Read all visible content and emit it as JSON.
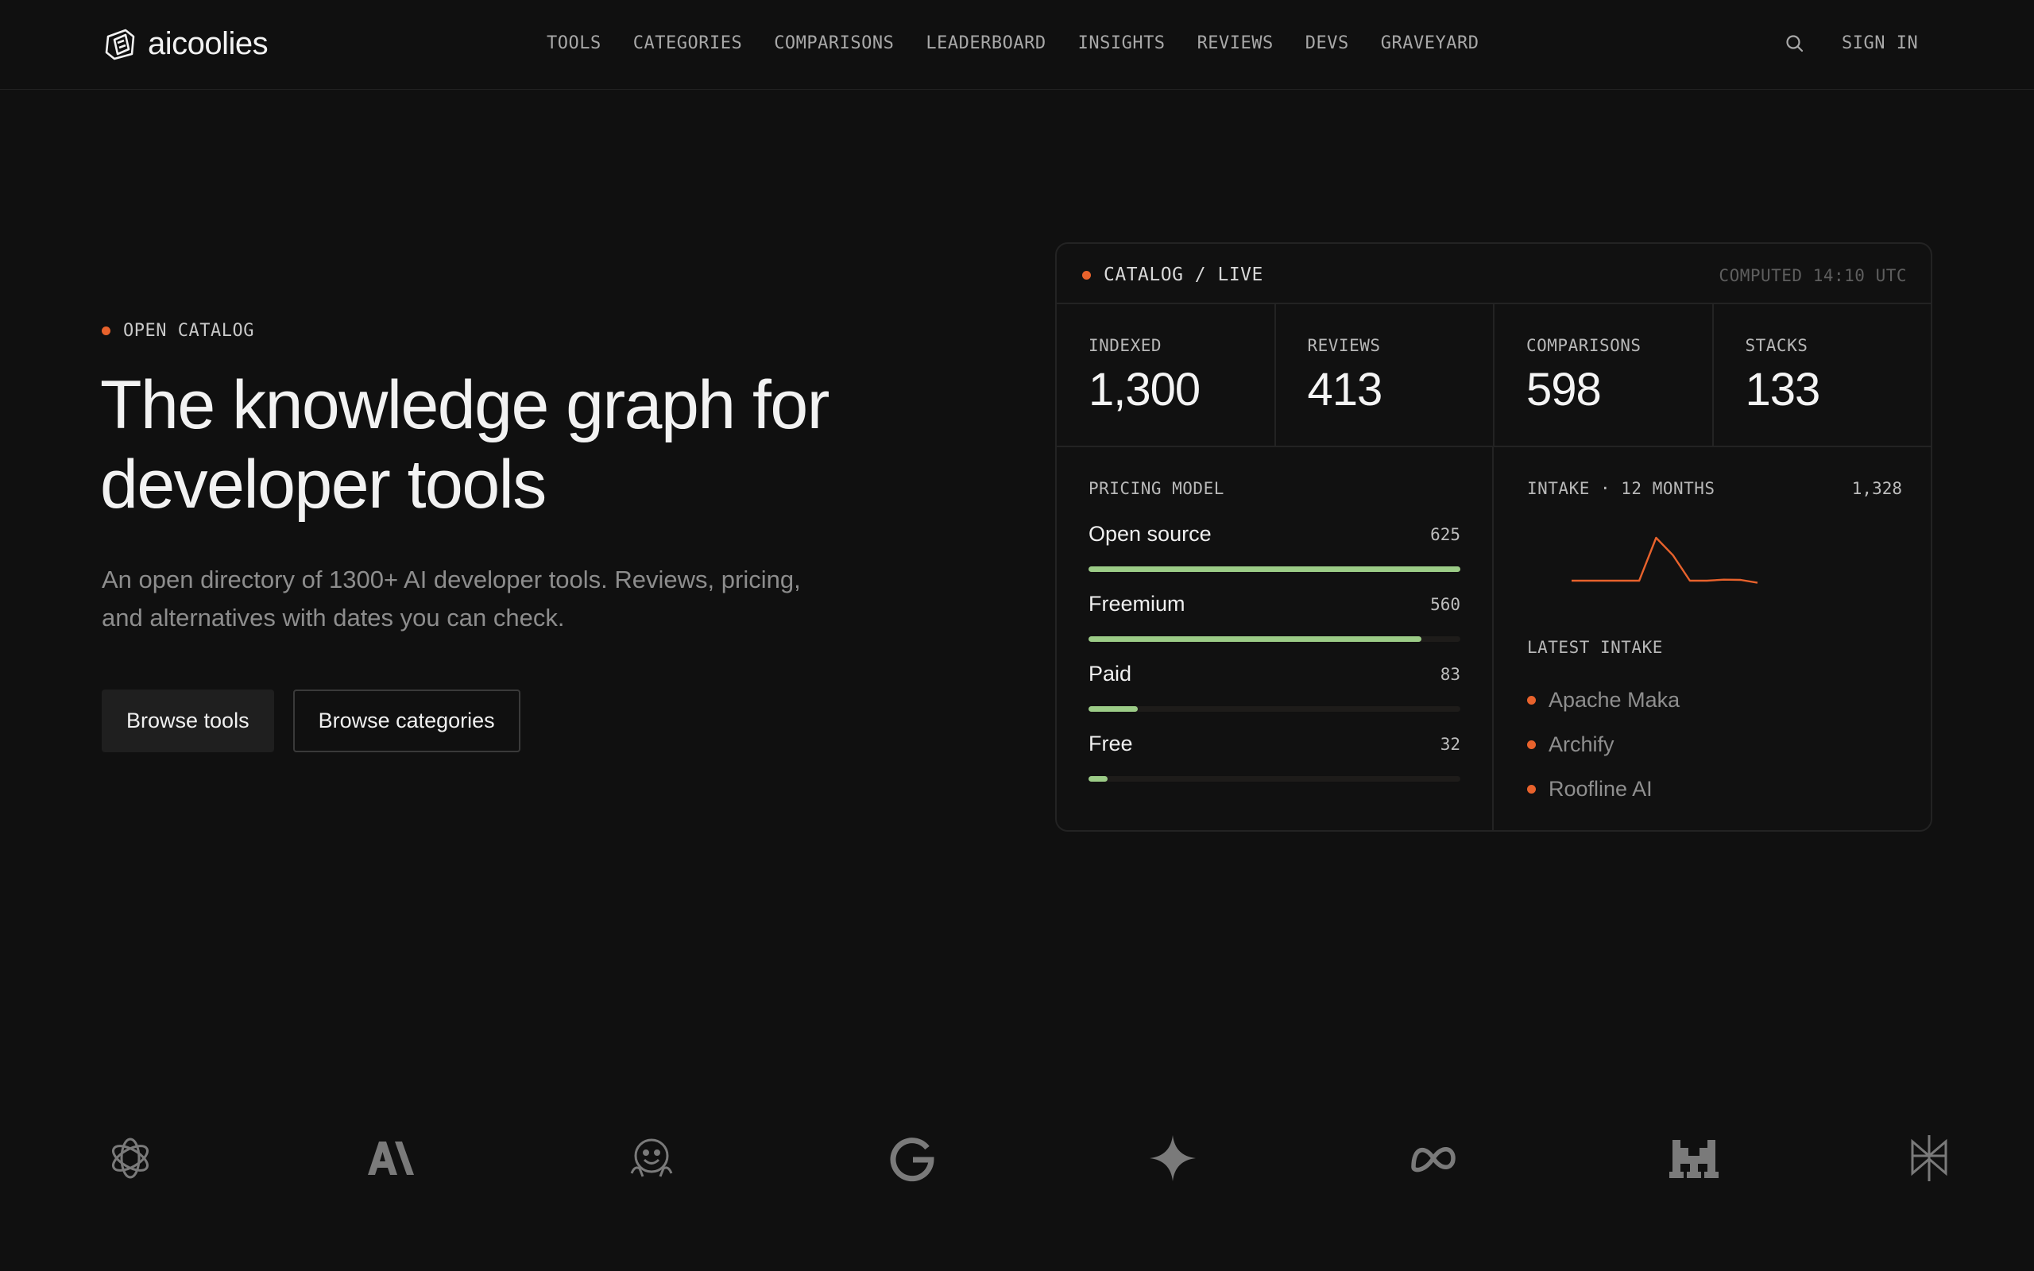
{
  "brand": {
    "name": "aicoolies"
  },
  "nav": {
    "links": [
      "TOOLS",
      "CATEGORIES",
      "COMPARISONS",
      "LEADERBOARD",
      "INSIGHTS",
      "REVIEWS",
      "DEVS",
      "GRAVEYARD"
    ],
    "signin_label": "SIGN IN"
  },
  "hero": {
    "eyebrow": "OPEN CATALOG",
    "title": "The knowledge graph for developer tools",
    "subtitle": "An open directory of 1300+ AI developer tools. Reviews, pricing, and alternatives with dates you can check.",
    "primary_button": "Browse tools",
    "secondary_button": "Browse categories"
  },
  "card": {
    "title": "CATALOG / LIVE",
    "computed": "COMPUTED 14:10 UTC",
    "stats": [
      {
        "label": "INDEXED",
        "value": "1,300"
      },
      {
        "label": "REVIEWS",
        "value": "413"
      },
      {
        "label": "COMPARISONS",
        "value": "598"
      },
      {
        "label": "STACKS",
        "value": "133"
      }
    ],
    "pricing": {
      "label": "PRICING MODEL",
      "rows": [
        {
          "name": "Open source",
          "count": "625",
          "fraction": 1.0
        },
        {
          "name": "Freemium",
          "count": "560",
          "fraction": 0.896
        },
        {
          "name": "Paid",
          "count": "83",
          "fraction": 0.133
        },
        {
          "name": "Free",
          "count": "32",
          "fraction": 0.051
        }
      ]
    },
    "intake": {
      "label": "INTAKE · 12 MONTHS",
      "total": "1,328",
      "monthly": [
        0,
        0,
        0,
        0,
        0,
        420,
        250,
        0,
        0,
        10,
        8,
        -20
      ],
      "latest_label": "LATEST INTAKE",
      "latest": [
        "Apache Maka",
        "Archify",
        "Roofline AI"
      ]
    }
  },
  "colors": {
    "accent": "#e8622c",
    "bar": "#9ccc87",
    "background": "#101010"
  },
  "logos": [
    "openai-icon",
    "anthropic-icon",
    "huggingface-icon",
    "google-icon",
    "gemini-icon",
    "meta-icon",
    "mistral-icon",
    "perplexity-icon"
  ]
}
